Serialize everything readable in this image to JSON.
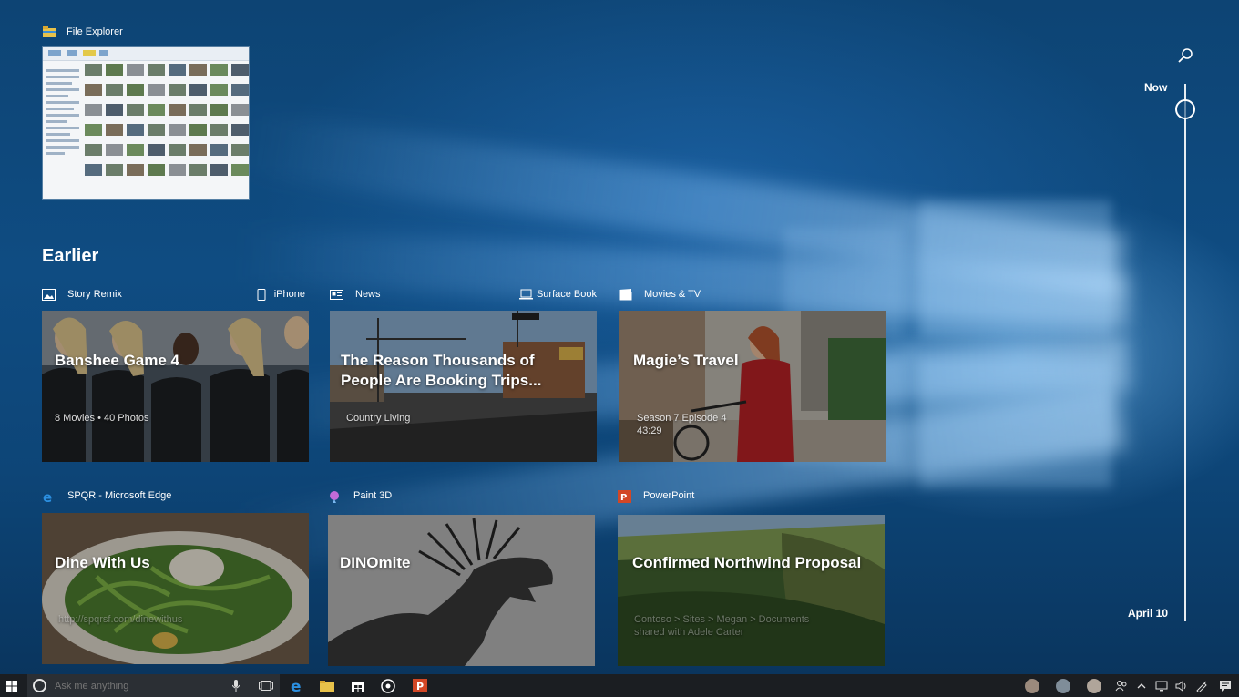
{
  "current": {
    "app_name": "File Explorer"
  },
  "section_title": "Earlier",
  "cards_row1": [
    {
      "app": "Story Remix",
      "device": "iPhone",
      "title": "Banshee Game 4",
      "subtitle": "8 Movies • 40 Photos"
    },
    {
      "app": "News",
      "device": "Surface Book",
      "title": "The Reason Thousands of People Are Booking Trips...",
      "subtitle": "Country Living"
    },
    {
      "app": "Movies & TV",
      "device": "",
      "title": "Magie’s Travel",
      "subtitle": "Season 7 Episode 4",
      "subtitle2": "43:29"
    }
  ],
  "cards_row2": [
    {
      "app": "SPQR - Microsoft Edge",
      "title": "Dine With Us",
      "subtitle": "http://spqrsf.com/dinewithus"
    },
    {
      "app": "Paint 3D",
      "title": "DINOmite",
      "subtitle": ""
    },
    {
      "app": "PowerPoint",
      "title": "Confirmed Northwind Proposal",
      "subtitle": "Contoso > Sites > Megan > Documents",
      "subtitle2": "shared with Adele Carter"
    }
  ],
  "timeline": {
    "top_label": "Now",
    "bottom_label": "April 10"
  },
  "taskbar": {
    "search_placeholder": "Ask me anything"
  },
  "colors": {
    "taskbar": "#1b1e22",
    "edge_blue": "#2b8fe0",
    "powerpoint": "#d24726",
    "paint3d": "#c26bd8"
  }
}
